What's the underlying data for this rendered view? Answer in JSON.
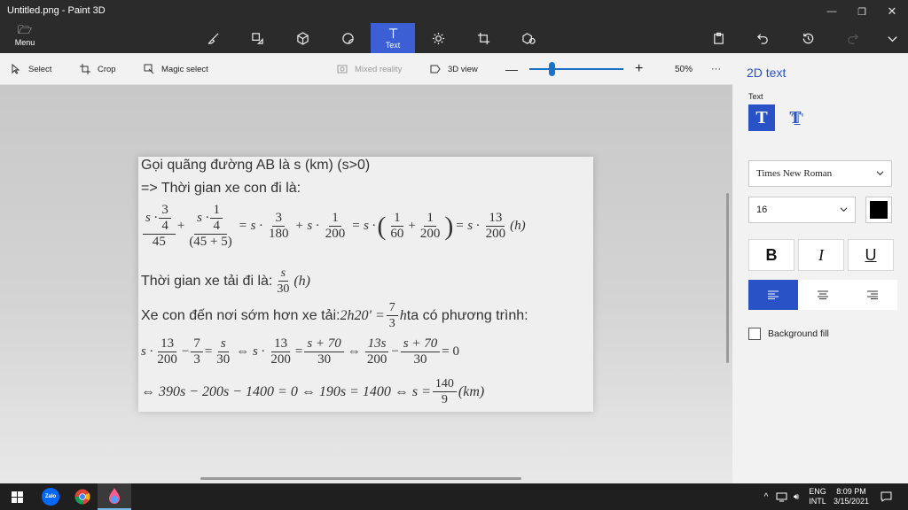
{
  "window": {
    "title": "Untitled.png - Paint 3D"
  },
  "ribbon": {
    "menu_label": "Menu",
    "tools": [
      {
        "name": "brushes-tool",
        "icon": "brush-icon"
      },
      {
        "name": "2d-shapes-tool",
        "icon": "2d-shapes-icon"
      },
      {
        "name": "3d-shapes-tool",
        "icon": "3d-shapes-icon"
      },
      {
        "name": "stickers-tool",
        "icon": "stickers-icon"
      },
      {
        "name": "text-tool",
        "icon": "text-icon",
        "label": "Text",
        "active": true
      },
      {
        "name": "effects-tool",
        "icon": "effects-icon"
      },
      {
        "name": "canvas-tool",
        "icon": "canvas-icon"
      },
      {
        "name": "3d-library-tool",
        "icon": "3d-library-icon"
      }
    ],
    "right_icons": [
      "paste-icon",
      "undo-icon",
      "history-icon",
      "redo-icon",
      "expand-chevron-icon"
    ]
  },
  "toolbar": {
    "select_label": "Select",
    "crop_label": "Crop",
    "magic_select_label": "Magic select",
    "mixed_reality_label": "Mixed reality",
    "view3d_label": "3D view",
    "zoom_level": "50%",
    "zoom_fraction": 0.24,
    "more_label": "···"
  },
  "canvas_image": {
    "line1": "Gọi quãng đường AB là s (km) (s>0)",
    "line2": "=> Thời gian xe con đi là:",
    "eq1": {
      "f1_num_top": "s · ",
      "f1_num_frac_n": "3",
      "f1_num_frac_d": "4",
      "f1_den": "45",
      "plus1": "+",
      "f2_num_top": "s · ",
      "f2_num_frac_n": "1",
      "f2_num_frac_d": "4",
      "f2_den": "(45 + 5)",
      "eq_s": "= s ·",
      "f3_n": "3",
      "f3_d": "180",
      "plus_s": "+ s ·",
      "f4_n": "1",
      "f4_d": "200",
      "eq_s2": "= s ·",
      "f5_n": "1",
      "f5_d": "60",
      "plus2": "+",
      "f6_n": "1",
      "f6_d": "200",
      "eq_s3": "= s ·",
      "f7_n": "13",
      "f7_d": "200",
      "unit": "(h)"
    },
    "line4_text": "Thời gian xe tải đi là:",
    "line4_f_n": "s",
    "line4_f_d": "30",
    "line4_unit": "(h)",
    "line5_text": "Xe con đến nơi sớm hơn xe tải: ",
    "line5_math": "2h20′ =",
    "line5_f_n": "7",
    "line5_f_d": "3",
    "line5_tail_h": "h",
    "line5_tail": " ta có phương trình:",
    "eq2": {
      "s_dot": "s ·",
      "a_n": "13",
      "a_d": "200",
      "minus": "−",
      "b_n": "7",
      "b_d": "3",
      "eq": "=",
      "c_n": "s",
      "c_d": "30",
      "iff1": "⇔ s ·",
      "d_n": "13",
      "d_d": "200",
      "eq2": "=",
      "e_n": "s + 70",
      "e_d": "30",
      "iff2": "⇔",
      "f_n": "13s",
      "f_d": "200",
      "minus2": "−",
      "g_n": "s + 70",
      "g_d": "30",
      "tail": "= 0"
    },
    "line7": {
      "text": "⇔ 390s − 200s − 1400 = 0 ⇔ 190s = 1400 ⇔ s =",
      "f_n": "140",
      "f_d": "9",
      "unit": "(km)"
    }
  },
  "panel": {
    "title": "2D text",
    "text_label": "Text",
    "plain_text_glyph": "T",
    "text3d_glyph": "T",
    "font_family_value": "Times New Roman",
    "font_size_value": "16",
    "text_color": "#000000",
    "bold_label": "B",
    "italic_label": "I",
    "underline_label": "U",
    "background_fill_label": "Background fill"
  },
  "taskbar": {
    "language_top": "ENG",
    "language_bottom": "INTL",
    "time": "8:09 PM",
    "date": "3/15/2021",
    "apps": [
      "zalo-app-icon",
      "chrome-app-icon",
      "paint-3d-app-icon"
    ],
    "zalo_label": "Zalo"
  },
  "colors": {
    "accent": "#3c5fd6",
    "panel_accent": "#2a52c7",
    "slider": "#1a73c6"
  }
}
